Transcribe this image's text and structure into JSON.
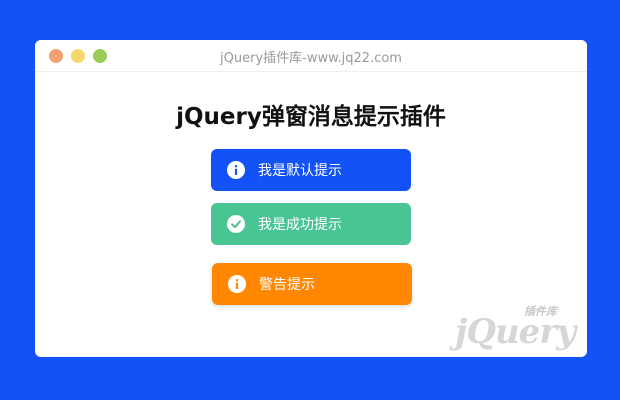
{
  "window": {
    "title": "jQuery插件库-www.jq22.com"
  },
  "page": {
    "heading": "jQuery弹窗消息提示插件"
  },
  "buttons": [
    {
      "label": "我是默认提示",
      "icon": "info-icon",
      "color": "#1352f7"
    },
    {
      "label": "我是成功提示",
      "icon": "check-icon",
      "color": "#49c493"
    },
    {
      "label": "警告提示",
      "icon": "info-icon",
      "color": "#ff8702"
    }
  ],
  "logo": {
    "cn_text": "插件库",
    "en_text": "jQuery"
  },
  "colors": {
    "background": "#1352f7",
    "window": "#ffffff"
  }
}
